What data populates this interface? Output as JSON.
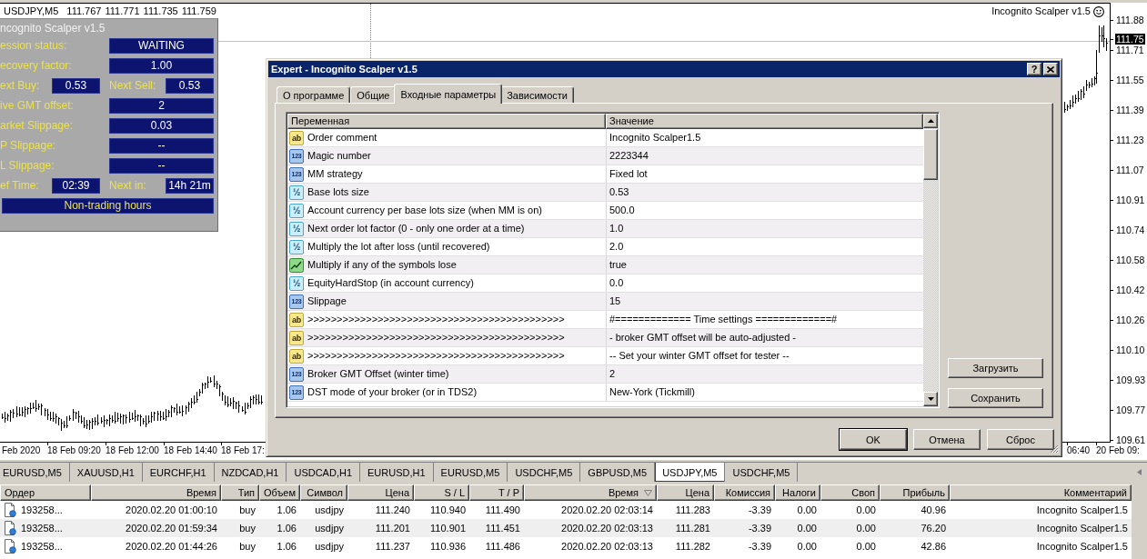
{
  "chart": {
    "symbol": "USDJPY,M5",
    "quotes": [
      "111.767",
      "111.771",
      "111.735",
      "111.759"
    ],
    "indicator_label": "Incognito Scalper v1.5",
    "price_axis": {
      "ticks": [
        "111.88",
        "111.71",
        "111.55",
        "111.39",
        "111.23",
        "111.07",
        "110.91",
        "110.74",
        "110.58",
        "110.42",
        "110.26",
        "110.10",
        "109.93",
        "109.77",
        "109.61"
      ],
      "current_price": "111.75"
    },
    "time_axis": [
      "Feb 2020",
      "18 Feb 09:20",
      "18 Feb 12:00",
      "18 Feb 14:40",
      "18 Feb 17:",
      "06:40",
      "20 Feb 09:"
    ]
  },
  "panel": {
    "title": "ncognito Scalper v1.5",
    "rows": [
      {
        "kind": "wide",
        "label": "ession status:",
        "value": "WAITING"
      },
      {
        "kind": "wide",
        "label": "ecovery factor:",
        "value": "1.00"
      },
      {
        "kind": "pair",
        "label": "ext Buy:",
        "value": "0.53",
        "label_2": "Next Sell:",
        "value_2": "0.53"
      },
      {
        "kind": "wide",
        "label": "ive GMT offset:",
        "value": "2"
      },
      {
        "kind": "wide",
        "label": "arket Slippage:",
        "value": "0.03"
      },
      {
        "kind": "wide",
        "label": "P Slippage:",
        "value": "--"
      },
      {
        "kind": "wide",
        "label": "L Slippage:",
        "value": "--"
      },
      {
        "kind": "pair",
        "label": "ef Time:",
        "value": "02:39",
        "label_2": "Next in:",
        "value_2": "14h 21m"
      },
      {
        "kind": "banner",
        "value": "Non-trading hours"
      }
    ]
  },
  "dialog": {
    "title": "Expert - Incognito Scalper v1.5",
    "help_button": "?",
    "tabs": [
      {
        "label": "О программе",
        "selected": false
      },
      {
        "label": "Общие",
        "selected": false
      },
      {
        "label": "Входные параметры",
        "selected": true
      },
      {
        "label": "Зависимости",
        "selected": false
      }
    ],
    "columns": [
      "Переменная",
      "Значение"
    ],
    "params": [
      {
        "kind": "string",
        "badge": "ab",
        "name": "Order comment",
        "value": "Incognito Scalper1.5"
      },
      {
        "kind": "int",
        "badge": "123",
        "name": "Magic number",
        "value": "2223344"
      },
      {
        "kind": "int",
        "badge": "123",
        "name": "MM strategy",
        "value": "Fixed lot"
      },
      {
        "kind": "double",
        "badge": "½",
        "name": "Base lots size",
        "value": "0.53"
      },
      {
        "kind": "double",
        "badge": "½",
        "name": "Account currency per base lots size (when MM is on)",
        "value": "500.0"
      },
      {
        "kind": "double",
        "badge": "½",
        "name": "Next order lot factor (0 - only one order at a time)",
        "value": "1.0"
      },
      {
        "kind": "double",
        "badge": "½",
        "name": "Multiply the lot after loss (until recovered)",
        "value": "2.0"
      },
      {
        "kind": "bool",
        "name": "Multiply if any of the symbols lose",
        "value": "true"
      },
      {
        "kind": "double",
        "badge": "½",
        "name": "EquityHardStop (in account currency)",
        "value": "0.0"
      },
      {
        "kind": "int",
        "badge": "123",
        "name": "Slippage",
        "value": "15"
      },
      {
        "kind": "string",
        "badge": "ab",
        "name": ">>>>>>>>>>>>>>>>>>>>>>>>>>>>>>>>>>>>>>>>>>>>",
        "value": "#============= Time settings =============#"
      },
      {
        "kind": "string",
        "badge": "ab",
        "name": ">>>>>>>>>>>>>>>>>>>>>>>>>>>>>>>>>>>>>>>>>>>>",
        "value": "- broker GMT offset will be auto-adjusted -"
      },
      {
        "kind": "string",
        "badge": "ab",
        "name": ">>>>>>>>>>>>>>>>>>>>>>>>>>>>>>>>>>>>>>>>>>>>",
        "value": "-- Set your winter GMT offset for tester --"
      },
      {
        "kind": "int",
        "badge": "123",
        "name": "Broker GMT Offset (winter time)",
        "value": "2"
      },
      {
        "kind": "int",
        "badge": "123",
        "name": "DST mode of your broker (or in TDS2)",
        "value": "New-York (Tickmill)"
      }
    ],
    "side_buttons": [
      "Загрузить",
      "Сохранить"
    ],
    "buttons": [
      {
        "label": "OK",
        "default": true
      },
      {
        "label": "Отмена",
        "default": false
      },
      {
        "label": "Сброс",
        "default": false
      }
    ]
  },
  "symbol_tabs": [
    {
      "label": "EURUSD,M5",
      "selected": false
    },
    {
      "label": "XAUUSD,H1",
      "selected": false
    },
    {
      "label": "EURCHF,H1",
      "selected": false
    },
    {
      "label": "NZDCAD,H1",
      "selected": false
    },
    {
      "label": "USDCAD,H1",
      "selected": false
    },
    {
      "label": "EURUSD,H1",
      "selected": false
    },
    {
      "label": "EURUSD,M5",
      "selected": false
    },
    {
      "label": "USDCHF,M5",
      "selected": false
    },
    {
      "label": "GBPUSD,M5",
      "selected": false
    },
    {
      "label": "USDJPY,M5",
      "selected": true
    },
    {
      "label": "USDCHF,M5",
      "selected": false
    }
  ],
  "orders": {
    "columns": [
      {
        "label": "Ордер",
        "sorted": false
      },
      {
        "label": "Время",
        "sorted": false
      },
      {
        "label": "Тип",
        "sorted": false
      },
      {
        "label": "Объем",
        "sorted": false
      },
      {
        "label": "Символ",
        "sorted": false
      },
      {
        "label": "Цена",
        "sorted": false
      },
      {
        "label": "S / L",
        "sorted": false
      },
      {
        "label": "T / P",
        "sorted": false
      },
      {
        "label": "Время",
        "sorted": true
      },
      {
        "label": "Цена",
        "sorted": false
      },
      {
        "label": "Комиссия",
        "sorted": false
      },
      {
        "label": "Налоги",
        "sorted": false
      },
      {
        "label": "Своп",
        "sorted": false
      },
      {
        "label": "Прибыль",
        "sorted": false
      },
      {
        "label": "Комментарий",
        "sorted": false
      }
    ],
    "rows": [
      [
        "193258...",
        "2020.02.20 01:00:10",
        "buy",
        "1.06",
        "usdjpy",
        "111.240",
        "110.940",
        "111.490",
        "2020.02.20 02:03:14",
        "111.283",
        "-3.39",
        "0.00",
        "0.00",
        "40.96",
        "Incognito Scalper1.5"
      ],
      [
        "193258...",
        "2020.02.20 01:59:34",
        "buy",
        "1.06",
        "usdjpy",
        "111.201",
        "110.901",
        "111.451",
        "2020.02.20 02:03:13",
        "111.281",
        "-3.39",
        "0.00",
        "0.00",
        "76.20",
        "Incognito Scalper1.5"
      ],
      [
        "193258...",
        "2020.02.20 01:44:26",
        "buy",
        "1.06",
        "usdjpy",
        "111.237",
        "110.936",
        "111.486",
        "2020.02.20 02:03:13",
        "111.282",
        "-3.39",
        "0.00",
        "0.00",
        "42.86",
        "Incognito Scalper1.5"
      ]
    ]
  }
}
